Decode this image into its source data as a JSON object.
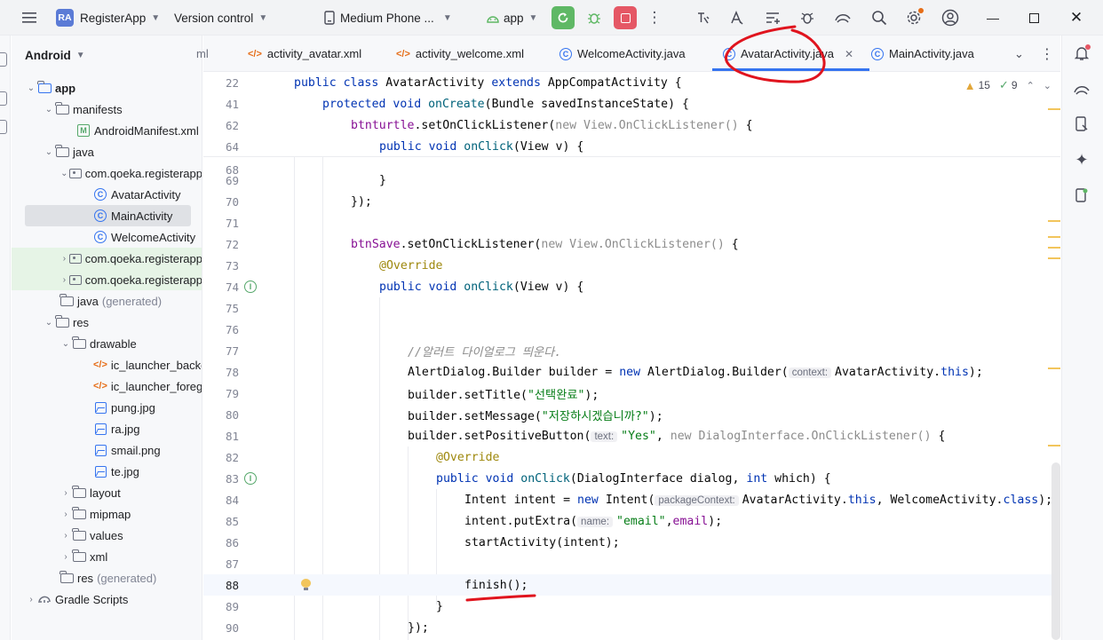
{
  "titlebar": {
    "project_badge": "RA",
    "project_name": "RegisterApp",
    "vcs_label": "Version control",
    "device_label": "Medium Phone ...",
    "run_config": "app"
  },
  "project_panel": {
    "view_label": "Android",
    "tree": [
      {
        "label": "app",
        "icon": "module-folder-icon"
      },
      {
        "label": "manifests",
        "icon": "folder-icon"
      },
      {
        "label": "AndroidManifest.xml",
        "icon": "manifest-icon"
      },
      {
        "label": "java",
        "icon": "folder-icon"
      },
      {
        "label": "com.qoeka.registerapp",
        "icon": "package-icon"
      },
      {
        "label": "AvatarActivity",
        "icon": "class-icon"
      },
      {
        "label": "MainActivity",
        "icon": "class-icon"
      },
      {
        "label": "WelcomeActivity",
        "icon": "class-icon"
      },
      {
        "label": "com.qoeka.registerapp",
        "icon": "package-icon"
      },
      {
        "label": "com.qoeka.registerapp",
        "icon": "package-icon"
      },
      {
        "label": "java",
        "suffix": "(generated)",
        "icon": "folder-icon"
      },
      {
        "label": "res",
        "icon": "folder-icon"
      },
      {
        "label": "drawable",
        "icon": "folder-icon"
      },
      {
        "label": "ic_launcher_background.xml",
        "icon": "xml-icon"
      },
      {
        "label": "ic_launcher_foreground.xml",
        "icon": "xml-icon"
      },
      {
        "label": "pung.jpg",
        "icon": "image-icon"
      },
      {
        "label": "ra.jpg",
        "icon": "image-icon"
      },
      {
        "label": "smail.png",
        "icon": "image-icon"
      },
      {
        "label": "te.jpg",
        "icon": "image-icon"
      },
      {
        "label": "layout",
        "icon": "folder-icon"
      },
      {
        "label": "mipmap",
        "icon": "folder-icon"
      },
      {
        "label": "values",
        "icon": "folder-icon"
      },
      {
        "label": "xml",
        "icon": "folder-icon"
      },
      {
        "label": "res",
        "suffix": "(generated)",
        "icon": "folder-icon"
      },
      {
        "label": "Gradle Scripts",
        "icon": "gradle-icon"
      }
    ]
  },
  "tabs": [
    {
      "label": "activity_avatar.xml"
    },
    {
      "label": "activity_welcome.xml"
    },
    {
      "label": "WelcomeActivity.java"
    },
    {
      "label": "AvatarActivity.java"
    },
    {
      "label": "MainActivity.java"
    }
  ],
  "inspections": {
    "warnings": "15",
    "ok": "9"
  },
  "editor": {
    "sticky": [
      {
        "no": "22",
        "code": "public class AvatarActivity extends AppCompatActivity {"
      },
      {
        "no": "41",
        "code": "protected void onCreate(Bundle savedInstanceState) {"
      },
      {
        "no": "62",
        "code": "btnturtle.setOnClickListener(new View.OnClickListener() {"
      },
      {
        "no": "64",
        "code": "public void onClick(View v) {"
      }
    ],
    "lines": [
      {
        "no": "68",
        "code": ""
      },
      {
        "no": "69",
        "code": "}"
      },
      {
        "no": "70",
        "code": "});"
      },
      {
        "no": "71",
        "code": ""
      },
      {
        "no": "72",
        "code": "btnSave.setOnClickListener(new View.OnClickListener() {"
      },
      {
        "no": "73",
        "code": "@Override"
      },
      {
        "no": "74",
        "code": "public void onClick(View v) {"
      },
      {
        "no": "75",
        "code": ""
      },
      {
        "no": "76",
        "code": ""
      },
      {
        "no": "77",
        "code": "//알러트 다이얼로그 띄운다."
      },
      {
        "no": "78",
        "code": "AlertDialog.Builder builder = new AlertDialog.Builder(AvatarActivity.this);"
      },
      {
        "no": "79",
        "code": "builder.setTitle(\"선택완료\");"
      },
      {
        "no": "80",
        "code": "builder.setMessage(\"저장하시겠습니까?\");"
      },
      {
        "no": "81",
        "code": "builder.setPositiveButton(\"Yes\", new DialogInterface.OnClickListener() {"
      },
      {
        "no": "82",
        "code": "@Override"
      },
      {
        "no": "83",
        "code": "public void onClick(DialogInterface dialog, int which) {"
      },
      {
        "no": "84",
        "code": "Intent intent = new Intent(AvatarActivity.this, WelcomeActivity.class);"
      },
      {
        "no": "85",
        "code": "intent.putExtra(\"email\",email);"
      },
      {
        "no": "86",
        "code": "startActivity(intent);"
      },
      {
        "no": "87",
        "code": ""
      },
      {
        "no": "88",
        "code": "finish();"
      },
      {
        "no": "89",
        "code": "}"
      },
      {
        "no": "90",
        "code": "});"
      }
    ],
    "hints": {
      "context": "context:",
      "text": "text:",
      "packageContext": "packageContext:",
      "name": "name:"
    }
  },
  "colors": {
    "accent": "#3574f0",
    "annotation_red": "#e0141e",
    "run_green": "#5fb865",
    "stop_red": "#e55765"
  }
}
